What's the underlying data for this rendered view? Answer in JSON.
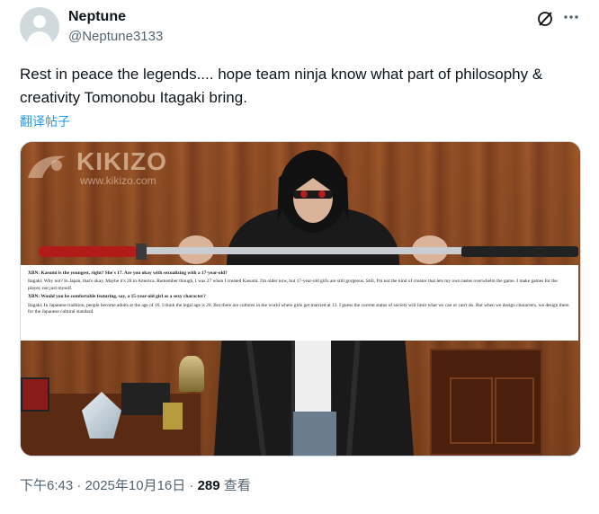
{
  "author": {
    "name": "Neptune",
    "handle": "@Neptune3133"
  },
  "tweet": {
    "text": "Rest in peace the legends.... hope team ninja know what part of philosophy & creativity Tomonobu Itagaki bring.",
    "translate_label": "翻译帖子"
  },
  "media": {
    "watermark": "KIKIZO",
    "watermark_url": "www.kikizo.com",
    "overlay": {
      "q1": "XBN: Kasumi is the youngest, right? She's 17. Are you okay with sexualizing with a 17-year-old?",
      "a1": "Itagaki: Why not? In Japan, that's okay. Maybe it's 20 in America. Remember though, I was 27 when I created Kasumi. I'm older now, but 17-year-old girls are still gorgeous. Still, I'm not the kind of creator that lets my own tastes overwhelm the game. I make games for the player, not just myself.",
      "q2": "XBN: Would you be comfortable featuring, say, a 15-year-old girl as a sexy character?",
      "a2": "Itagaki: In Japanese tradition, people become adults at the age of 16. I think the legal age is 20. But there are cultures in the world where girls get married at 13. I guess the current status of society will limit what we can or can't do. But when we design characters, we design them for the Japanese cultural standard."
    }
  },
  "footer": {
    "time": "下午6:43 · 2025年10月16日 · ",
    "views_count": "289",
    "views_label": " 查看"
  },
  "icons": {
    "grok": "grok-icon",
    "more": "more-icon"
  },
  "colors": {
    "link": "#1d9bf0",
    "secondary_text": "#536471",
    "primary_text": "#0f1419"
  }
}
